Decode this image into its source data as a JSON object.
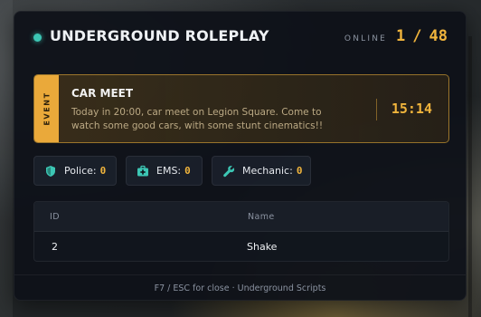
{
  "header": {
    "title": "UNDERGROUND ROLEPLAY",
    "online_label": "ONLINE",
    "online_count": "1",
    "online_separator": "/",
    "online_max": "48"
  },
  "event": {
    "tag": "EVENT",
    "title": "CAR MEET",
    "description": "Today in 20:00, car meet on Legion Square. Come to watch some good cars, with some stunt cinematics!!",
    "time": "15:14"
  },
  "stats": [
    {
      "label": "Police:",
      "value": "0",
      "icon": "shield-icon"
    },
    {
      "label": "EMS:",
      "value": "0",
      "icon": "medkit-icon"
    },
    {
      "label": "Mechanic:",
      "value": "0",
      "icon": "wrench-icon"
    }
  ],
  "table": {
    "columns": [
      "ID",
      "Name"
    ],
    "rows": [
      {
        "id": "2",
        "name": "Shake"
      }
    ]
  },
  "footer": {
    "text": "F7 / ESC for close · Underground Scripts"
  },
  "colors": {
    "accent": "#f0b43c",
    "status": "#3cc6b4",
    "panel": "#0e1118"
  }
}
